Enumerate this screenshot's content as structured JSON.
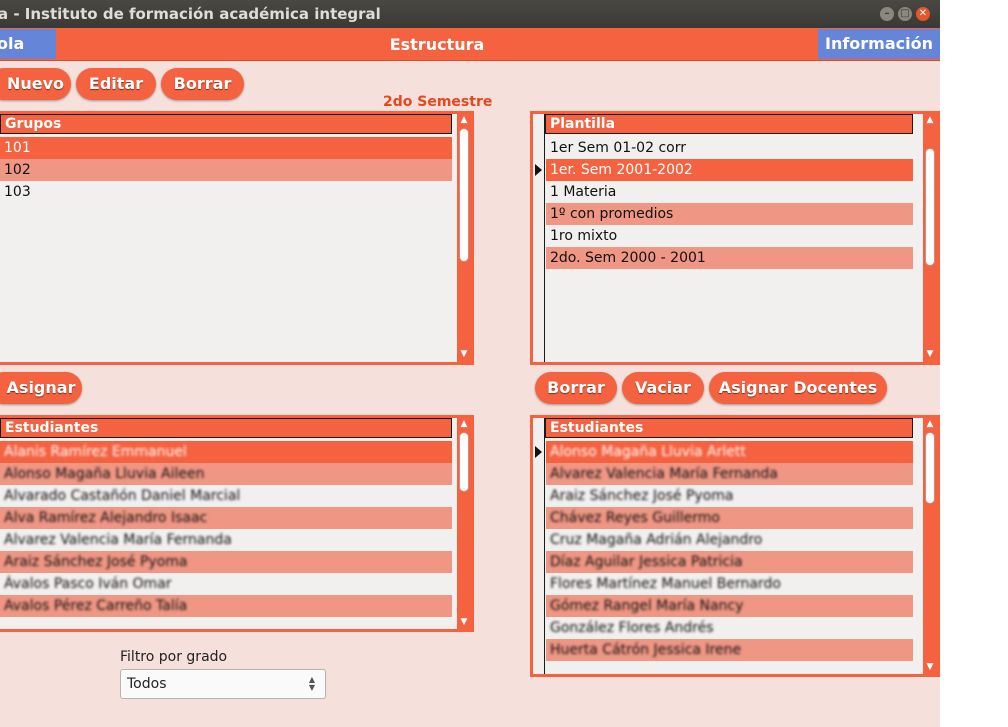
{
  "window": {
    "title": "a - Instituto de formación académica integral",
    "controls": [
      "minimize",
      "maximize",
      "close"
    ]
  },
  "tabs": {
    "left": "ola",
    "center": "Estructura",
    "right": "Información"
  },
  "toolbar": {
    "nuevo": "Nuevo",
    "editar": "Editar",
    "borrar": "Borrar"
  },
  "semester_label": "2do Semestre",
  "grupos": {
    "header": "Grupos",
    "rows": [
      "101",
      "102",
      "103"
    ]
  },
  "plantilla": {
    "header": "Plantilla",
    "rows": [
      "1er Sem 01-02 corr",
      "1er. Sem 2001-2002",
      "1 Materia",
      "1º con promedios",
      "1ro mixto",
      "2do. Sem 2000 - 2001"
    ]
  },
  "asignar_label": "Asignar",
  "right_buttons": {
    "borrar": "Borrar",
    "vaciar": "Vaciar",
    "asignar_docentes": "Asignar Docentes"
  },
  "estudiantes_left": {
    "header": "Estudiantes",
    "rows": [
      "Alanis Ramírez Emmanuel",
      "Alonso Magaña Lluvia Aileen",
      "Alvarado Castañón Daniel Marcial",
      "Alva Ramírez Alejandro Isaac",
      "Alvarez Valencia María Fernanda",
      "Araiz Sánchez José Pyoma",
      "Ávalos Pasco Iván Omar",
      "Avalos Pérez Carreño Talía"
    ]
  },
  "estudiantes_right": {
    "header": "Estudiantes",
    "rows": [
      "Alonso Magaña Lluvia Arlett",
      "Alvarez Valencia María Fernanda",
      "Araiz Sánchez José Pyoma",
      "Chávez Reyes Guillermo",
      "Cruz Magaña Adrián Alejandro",
      "Díaz Aguilar Jessica Patricia",
      "Flores Martínez Manuel Bernardo",
      "Gómez Rangel María Nancy",
      "González Flores Andrés",
      "Huerta Cátrón Jessica Irene"
    ]
  },
  "filter": {
    "label": "Filtro por grado",
    "value": "Todos"
  },
  "colors": {
    "accent": "#f56240",
    "tab_blue": "#6585d8",
    "alt_row": "#ef9684",
    "background": "#f5e0dc"
  }
}
